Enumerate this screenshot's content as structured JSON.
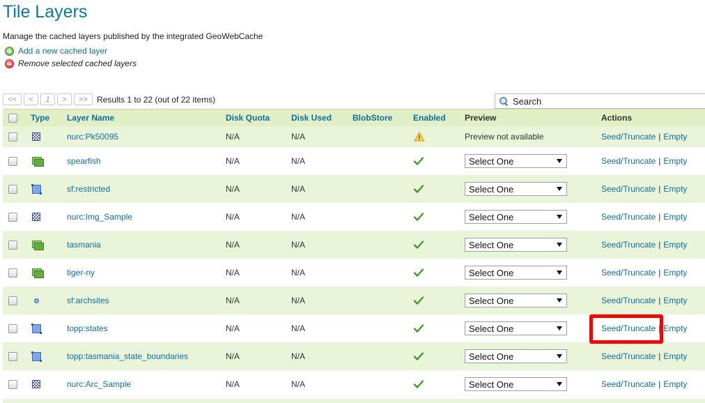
{
  "page": {
    "title": "Tile Layers",
    "description": "Manage the cached layers published by the integrated GeoWebCache",
    "add_label": "Add a new cached layer",
    "remove_label": "Remove selected cached layers"
  },
  "pager": {
    "first": "<<",
    "prev": "<",
    "current": "1",
    "next": ">",
    "last": ">>",
    "results": "Results 1 to 22 (out of 22 items)"
  },
  "search": {
    "placeholder": "Search"
  },
  "table": {
    "headers": {
      "type": "Type",
      "name": "Layer Name",
      "quota": "Disk Quota",
      "used": "Disk Used",
      "blob": "BlobStore",
      "enabled": "Enabled",
      "preview": "Preview",
      "actions": "Actions"
    },
    "preview_select_label": "Select One",
    "action_seed": "Seed/Truncate",
    "action_separator": "|",
    "action_empty": "Empty",
    "rows": [
      {
        "type": "raster",
        "name": "nurc:Pk50095",
        "quota": "N/A",
        "used": "N/A",
        "enabled": "warning",
        "preview": "Preview not available"
      },
      {
        "type": "group",
        "name": "spearfish",
        "quota": "N/A",
        "used": "N/A",
        "enabled": "check",
        "preview": "select"
      },
      {
        "type": "polygon",
        "name": "sf:restricted",
        "quota": "N/A",
        "used": "N/A",
        "enabled": "check",
        "preview": "select"
      },
      {
        "type": "raster",
        "name": "nurc:Img_Sample",
        "quota": "N/A",
        "used": "N/A",
        "enabled": "check",
        "preview": "select"
      },
      {
        "type": "group",
        "name": "tasmania",
        "quota": "N/A",
        "used": "N/A",
        "enabled": "check",
        "preview": "select"
      },
      {
        "type": "group",
        "name": "tiger-ny",
        "quota": "N/A",
        "used": "N/A",
        "enabled": "check",
        "preview": "select"
      },
      {
        "type": "point",
        "name": "sf:archsites",
        "quota": "N/A",
        "used": "N/A",
        "enabled": "check",
        "preview": "select"
      },
      {
        "type": "polygon",
        "name": "topp:states",
        "quota": "N/A",
        "used": "N/A",
        "enabled": "check",
        "preview": "select"
      },
      {
        "type": "polygon",
        "name": "topp:tasmania_state_boundaries",
        "quota": "N/A",
        "used": "N/A",
        "enabled": "check",
        "preview": "select"
      },
      {
        "type": "raster",
        "name": "nurc:Arc_Sample",
        "quota": "N/A",
        "used": "N/A",
        "enabled": "check",
        "preview": "select"
      }
    ]
  },
  "colors": {
    "link": "#0b6fa4",
    "header_bg": "#e1efc5",
    "odd_row_bg": "#eaf4d9",
    "highlight": "#ff0000"
  }
}
